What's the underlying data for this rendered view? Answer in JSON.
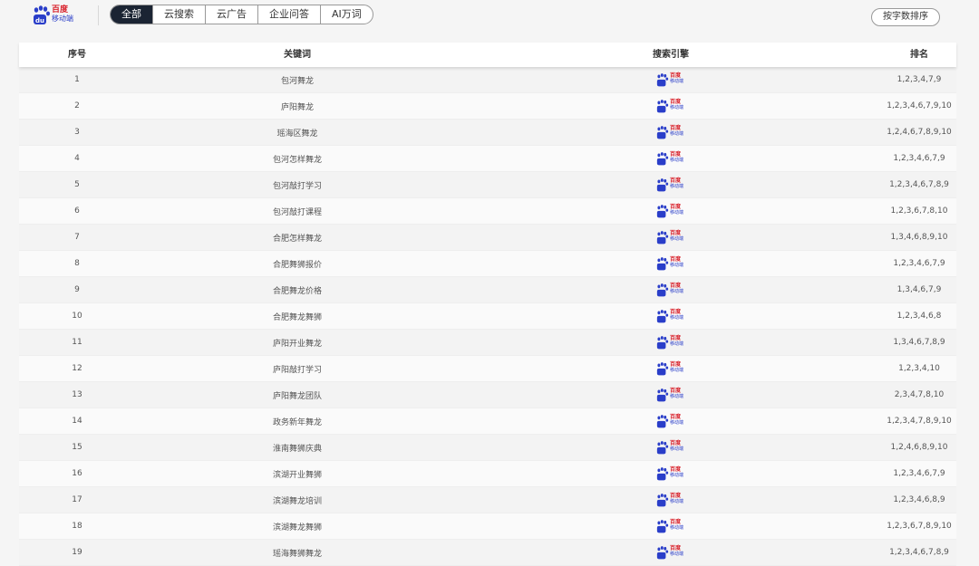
{
  "header": {
    "brand_line1": "百度",
    "brand_line2": "移动端",
    "brand_colors": {
      "red": "#d9232d",
      "blue": "#2a3ec9"
    },
    "tabs": [
      {
        "label": "全部",
        "active": true
      },
      {
        "label": "云搜索",
        "active": false
      },
      {
        "label": "云广告",
        "active": false
      },
      {
        "label": "企业问答",
        "active": false
      },
      {
        "label": "AI万词",
        "active": false
      }
    ],
    "sort_button": "按字数排序"
  },
  "table": {
    "columns": [
      "序号",
      "关键词",
      "搜索引擎",
      "排名"
    ],
    "engine_logo": {
      "icon": "baidu-paw-icon",
      "line1": "百度",
      "line2": "移动端"
    },
    "rows": [
      {
        "index": "1",
        "keyword": "包河舞龙",
        "rank": "1,2,3,4,7,9"
      },
      {
        "index": "2",
        "keyword": "庐阳舞龙",
        "rank": "1,2,3,4,6,7,9,10"
      },
      {
        "index": "3",
        "keyword": "瑶海区舞龙",
        "rank": "1,2,4,6,7,8,9,10"
      },
      {
        "index": "4",
        "keyword": "包河怎样舞龙",
        "rank": "1,2,3,4,6,7,9"
      },
      {
        "index": "5",
        "keyword": "包河敲打学习",
        "rank": "1,2,3,4,6,7,8,9"
      },
      {
        "index": "6",
        "keyword": "包河敲打课程",
        "rank": "1,2,3,6,7,8,10"
      },
      {
        "index": "7",
        "keyword": "合肥怎样舞龙",
        "rank": "1,3,4,6,8,9,10"
      },
      {
        "index": "8",
        "keyword": "合肥舞狮报价",
        "rank": "1,2,3,4,6,7,9"
      },
      {
        "index": "9",
        "keyword": "合肥舞龙价格",
        "rank": "1,3,4,6,7,9"
      },
      {
        "index": "10",
        "keyword": "合肥舞龙舞狮",
        "rank": "1,2,3,4,6,8"
      },
      {
        "index": "11",
        "keyword": "庐阳开业舞龙",
        "rank": "1,3,4,6,7,8,9"
      },
      {
        "index": "12",
        "keyword": "庐阳敲打学习",
        "rank": "1,2,3,4,10"
      },
      {
        "index": "13",
        "keyword": "庐阳舞龙团队",
        "rank": "2,3,4,7,8,10"
      },
      {
        "index": "14",
        "keyword": "政务新年舞龙",
        "rank": "1,2,3,4,7,8,9,10"
      },
      {
        "index": "15",
        "keyword": "淮南舞狮庆典",
        "rank": "1,2,4,6,8,9,10"
      },
      {
        "index": "16",
        "keyword": "滨湖开业舞狮",
        "rank": "1,2,3,4,6,7,9"
      },
      {
        "index": "17",
        "keyword": "滨湖舞龙培训",
        "rank": "1,2,3,4,6,8,9"
      },
      {
        "index": "18",
        "keyword": "滨湖舞龙舞狮",
        "rank": "1,2,3,6,7,8,9,10"
      },
      {
        "index": "19",
        "keyword": "瑶海舞狮舞龙",
        "rank": "1,2,3,4,6,7,8,9"
      }
    ]
  }
}
